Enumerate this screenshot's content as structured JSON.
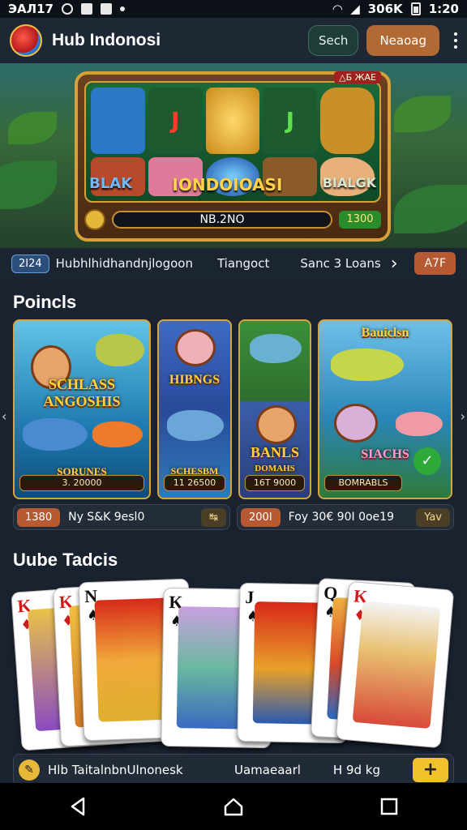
{
  "status": {
    "left": "ЭАЛ17",
    "carrier": "306K",
    "time": "1:20"
  },
  "app": {
    "title": "Hub Indonosi",
    "search_label": "Sech",
    "register_label": "Neaoag"
  },
  "hero": {
    "badge": "△Б ЖАЕ",
    "label_left": "BLAK",
    "label_center": "IONDOIOASI",
    "label_right": "BIALGK",
    "meter": "NB.2NO",
    "win": "1300"
  },
  "ticker": {
    "tag": "2I24",
    "text1": "Hubhlhidhandnjlogoon",
    "text2": "Tiangoct",
    "text3": "Sanc 3 Loans",
    "button": "A7F"
  },
  "section_games": "Poincls",
  "games": [
    {
      "title": "SCHLASS ANGOSHIS",
      "sub": "SORUNES",
      "bar": "3. 20000"
    },
    {
      "title": "HIBNGS",
      "sub": "SCHESBM",
      "bar": "11 26500"
    },
    {
      "title": "BANLS",
      "sub": "DOMAHS",
      "bar": "16T 9000"
    },
    {
      "title": "Bauiclsn",
      "sub": "SIACHS",
      "bar": "BOMRABLS"
    }
  ],
  "prizes": [
    {
      "chip": "1380",
      "text": "Ny S&K 9esl0",
      "go": "↹"
    },
    {
      "chip": "200I",
      "text": "Foy 30€ 90I 0oe19",
      "go": "Yav"
    }
  ],
  "section_cards": "Uube Tadcis",
  "cards": [
    {
      "rank": "K",
      "suit": "♦",
      "color": "red"
    },
    {
      "rank": "K",
      "suit": "♦",
      "color": "red"
    },
    {
      "rank": "N",
      "suit": "♠",
      "color": "black"
    },
    {
      "rank": "K",
      "suit": "♠",
      "color": "black"
    },
    {
      "rank": "J",
      "suit": "♠",
      "color": "black"
    },
    {
      "rank": "Q",
      "suit": "♠",
      "color": "black"
    },
    {
      "rank": "K",
      "suit": "♦",
      "color": "red"
    }
  ],
  "bottom": {
    "left": "Hlb TaitalnbnUlnonesk",
    "center": "Uamaeaarl",
    "right": "H 9d kg",
    "plus": "+"
  },
  "colors": {
    "accent_orange": "#b26a34",
    "accent_gold": "#f2c12e",
    "bg": "#1a2230"
  }
}
